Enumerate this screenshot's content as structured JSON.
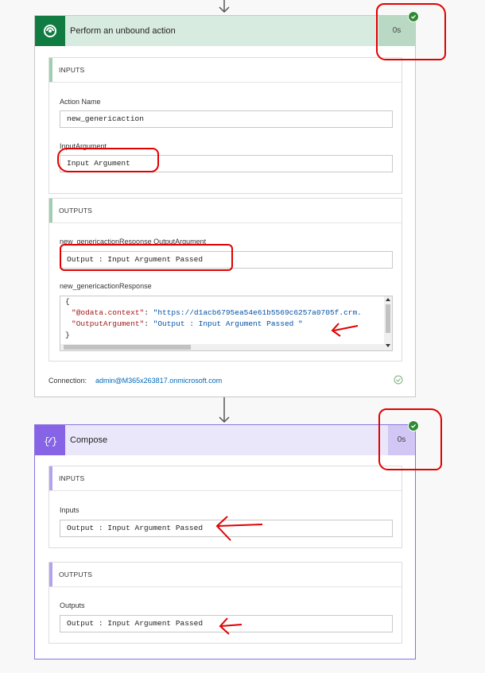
{
  "top_connector": {
    "icon": "arrow-down-icon"
  },
  "action1": {
    "title": "Perform an unbound action",
    "duration": "0s",
    "status_icon": "check-circle-icon",
    "header_color": "#d8ebe0",
    "icon_bg": "#107c41",
    "inputs": {
      "heading": "INPUTS",
      "action_name_label": "Action Name",
      "action_name_value": "new_genericaction",
      "input_argument_label": "InputArgument",
      "input_argument_value": "Input Argument"
    },
    "outputs": {
      "heading": "OUTPUTS",
      "response_output_label": "new_genericactionResponse OutputArgument",
      "response_output_value": "Output : Input Argument Passed",
      "response_label": "new_genericactionResponse",
      "json_open": "{",
      "json_line1_key": "\"@odata.context\"",
      "json_line1_sep": ": ",
      "json_line1_val": "\"https://d1acb6795ea54e61b5569c6257a0705f.crm.",
      "json_line2_key": "\"OutputArgument\"",
      "json_line2_sep": ": ",
      "json_line2_val": "\"Output : Input Argument Passed  \"",
      "json_close": "}"
    },
    "connection_label": "Connection:",
    "connection_value": "admin@M365x263817.onmicrosoft.com"
  },
  "middle_connector": {
    "icon": "arrow-down-icon"
  },
  "action2": {
    "title": "Compose",
    "duration": "0s",
    "status_icon": "check-circle-icon",
    "header_color": "#ebe7fa",
    "icon_bg": "#8764e6",
    "inputs": {
      "heading": "INPUTS",
      "label": "Inputs",
      "value": "Output : Input Argument Passed"
    },
    "outputs": {
      "heading": "OUTPUTS",
      "label": "Outputs",
      "value": "Output : Input Argument Passed"
    }
  }
}
